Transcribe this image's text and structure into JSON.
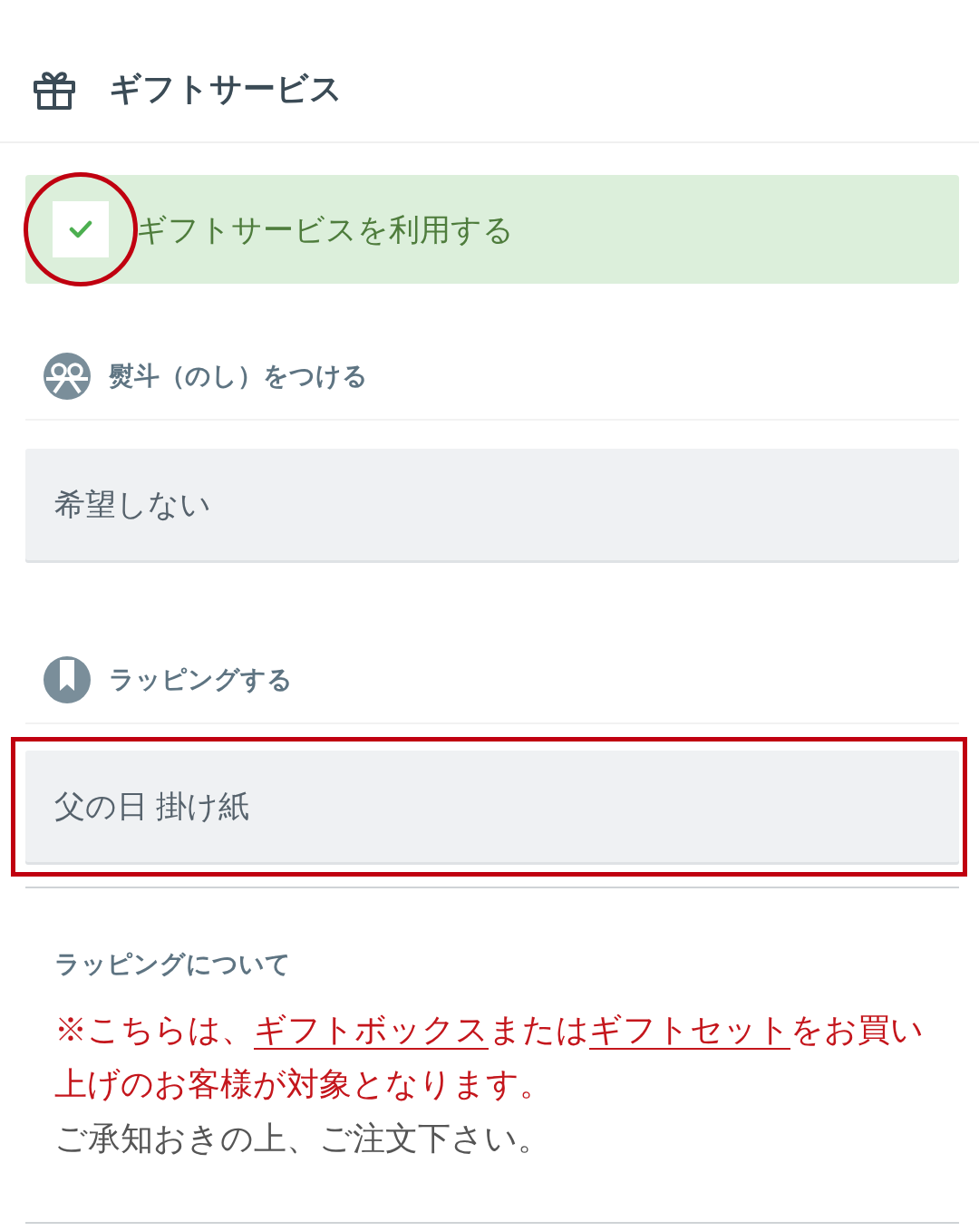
{
  "header": {
    "title": "ギフトサービス"
  },
  "gift_service": {
    "label": "ギフトサービスを利用する",
    "checked": true,
    "circled": true
  },
  "sections": [
    {
      "kind": "noshi",
      "heading": "熨斗（のし）をつける",
      "select": {
        "value": "希望しない",
        "framed": false
      }
    },
    {
      "kind": "wrapping",
      "heading": "ラッピングする",
      "select": {
        "value": "父の日 掛け紙",
        "framed": true
      }
    }
  ],
  "notice": {
    "title": "ラッピングについて",
    "parts": [
      {
        "kind": "text",
        "text": "※こちらは、"
      },
      {
        "kind": "link",
        "text": "ギフトボックス"
      },
      {
        "kind": "text",
        "text": "または"
      },
      {
        "kind": "link",
        "text": "ギフトセット"
      },
      {
        "kind": "text",
        "text": "をお買い上げのお客様が対象となります。"
      }
    ],
    "note": "ご承知おきの上、ご注文下さい。"
  }
}
